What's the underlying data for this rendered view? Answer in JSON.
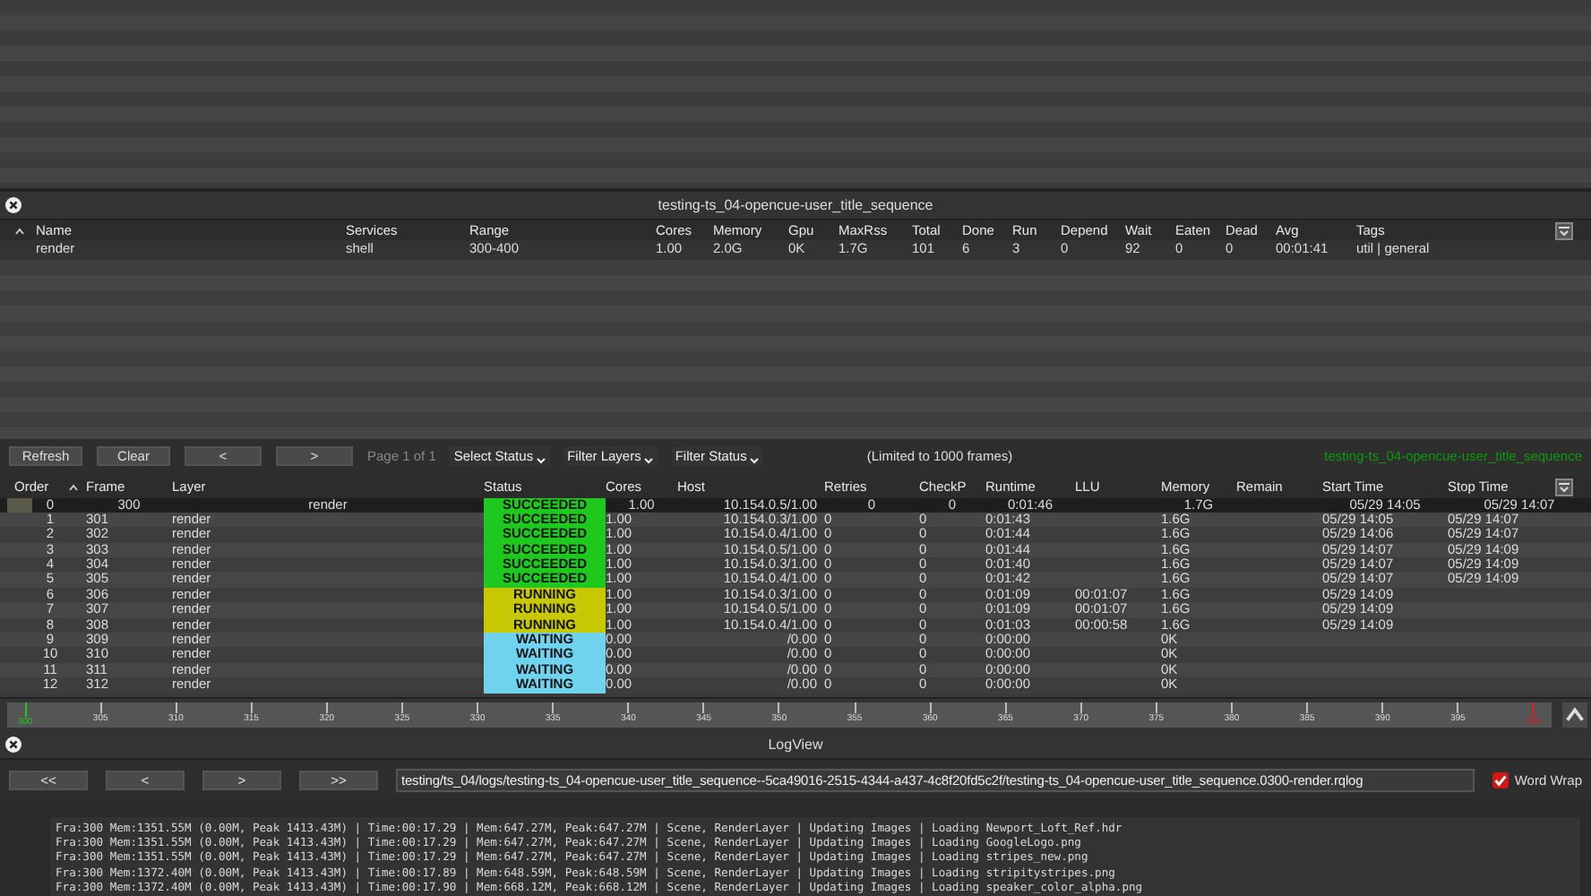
{
  "job_panel": {
    "title": "testing-ts_04-opencue-user_title_sequence",
    "columns": [
      "Name",
      "Services",
      "Range",
      "Cores",
      "Memory",
      "Gpu",
      "MaxRss",
      "Total",
      "Done",
      "Run",
      "Depend",
      "Wait",
      "Eaten",
      "Dead",
      "Avg",
      "Tags"
    ],
    "rows": [
      {
        "cells": [
          "render",
          "shell",
          "300-400",
          "1.00",
          "2.0G",
          "0K",
          "1.7G",
          "101",
          "6",
          "3",
          "0",
          "92",
          "0",
          "0",
          "00:01:41",
          "util | general"
        ]
      }
    ]
  },
  "frames_toolbar": {
    "buttons": [
      "Refresh",
      "Clear",
      "<",
      ">"
    ],
    "page_label": "Page 1 of 1",
    "menus": [
      "Select Status",
      "Filter Layers",
      "Filter Status"
    ],
    "limit_note": "(Limited to 1000 frames)",
    "job_name": "testing-ts_04-opencue-user_title_sequence"
  },
  "frames_table": {
    "columns": [
      "Order",
      "Frame",
      "Layer",
      "Status",
      "Cores",
      "Host",
      "Retries",
      "CheckP",
      "Runtime",
      "LLU",
      "Memory",
      "Remain",
      "Start Time",
      "Stop Time"
    ],
    "rows": [
      {
        "selected": true,
        "kind": "succeeded",
        "cells": [
          "0",
          "300",
          "render",
          "SUCCEEDED",
          "1.00",
          "10.154.0.5/1.00",
          "0",
          "0",
          "0:01:46",
          "",
          "1.7G",
          "",
          "05/29 14:05",
          "05/29 14:07"
        ]
      },
      {
        "selected": false,
        "kind": "succeeded",
        "cells": [
          "1",
          "301",
          "render",
          "SUCCEEDED",
          "1.00",
          "10.154.0.3/1.00",
          "0",
          "0",
          "0:01:43",
          "",
          "1.6G",
          "",
          "05/29 14:05",
          "05/29 14:07"
        ]
      },
      {
        "selected": false,
        "kind": "succeeded",
        "cells": [
          "2",
          "302",
          "render",
          "SUCCEEDED",
          "1.00",
          "10.154.0.4/1.00",
          "0",
          "0",
          "0:01:44",
          "",
          "1.6G",
          "",
          "05/29 14:06",
          "05/29 14:07"
        ]
      },
      {
        "selected": false,
        "kind": "succeeded",
        "cells": [
          "3",
          "303",
          "render",
          "SUCCEEDED",
          "1.00",
          "10.154.0.5/1.00",
          "0",
          "0",
          "0:01:44",
          "",
          "1.6G",
          "",
          "05/29 14:07",
          "05/29 14:09"
        ]
      },
      {
        "selected": false,
        "kind": "succeeded",
        "cells": [
          "4",
          "304",
          "render",
          "SUCCEEDED",
          "1.00",
          "10.154.0.3/1.00",
          "0",
          "0",
          "0:01:40",
          "",
          "1.6G",
          "",
          "05/29 14:07",
          "05/29 14:09"
        ]
      },
      {
        "selected": false,
        "kind": "succeeded",
        "cells": [
          "5",
          "305",
          "render",
          "SUCCEEDED",
          "1.00",
          "10.154.0.4/1.00",
          "0",
          "0",
          "0:01:42",
          "",
          "1.6G",
          "",
          "05/29 14:07",
          "05/29 14:09"
        ]
      },
      {
        "selected": false,
        "kind": "running",
        "cells": [
          "6",
          "306",
          "render",
          "RUNNING",
          "1.00",
          "10.154.0.3/1.00",
          "0",
          "0",
          "0:01:09",
          "00:01:07",
          "1.6G",
          "",
          "05/29 14:09",
          ""
        ]
      },
      {
        "selected": false,
        "kind": "running",
        "cells": [
          "7",
          "307",
          "render",
          "RUNNING",
          "1.00",
          "10.154.0.5/1.00",
          "0",
          "0",
          "0:01:09",
          "00:01:07",
          "1.6G",
          "",
          "05/29 14:09",
          ""
        ]
      },
      {
        "selected": false,
        "kind": "running",
        "cells": [
          "8",
          "308",
          "render",
          "RUNNING",
          "1.00",
          "10.154.0.4/1.00",
          "0",
          "0",
          "0:01:03",
          "00:00:58",
          "1.6G",
          "",
          "05/29 14:09",
          ""
        ]
      },
      {
        "selected": false,
        "kind": "waiting",
        "cells": [
          "9",
          "309",
          "render",
          "WAITING",
          "0.00",
          "/0.00",
          "0",
          "0",
          "0:00:00",
          "",
          "0K",
          "",
          "",
          ""
        ]
      },
      {
        "selected": false,
        "kind": "waiting",
        "cells": [
          "10",
          "310",
          "render",
          "WAITING",
          "0.00",
          "/0.00",
          "0",
          "0",
          "0:00:00",
          "",
          "0K",
          "",
          "",
          ""
        ]
      },
      {
        "selected": false,
        "kind": "waiting",
        "cells": [
          "11",
          "311",
          "render",
          "WAITING",
          "0.00",
          "/0.00",
          "0",
          "0",
          "0:00:00",
          "",
          "0K",
          "",
          "",
          ""
        ]
      },
      {
        "selected": false,
        "kind": "waiting",
        "cells": [
          "12",
          "312",
          "render",
          "WAITING",
          "0.00",
          "/0.00",
          "0",
          "0",
          "0:00:00",
          "",
          "0K",
          "",
          "",
          ""
        ]
      }
    ]
  },
  "timeline": {
    "ticks": [
      "300",
      "305",
      "310",
      "315",
      "320",
      "325",
      "330",
      "335",
      "340",
      "345",
      "350",
      "355",
      "360",
      "365",
      "370",
      "375",
      "380",
      "385",
      "390",
      "395",
      "400"
    ]
  },
  "log_view": {
    "title": "LogView",
    "nav_buttons": [
      "<<",
      "<",
      ">",
      ">>"
    ],
    "path": "testing/ts_04/logs/testing-ts_04-opencue-user_title_sequence--5ca49016-2515-4344-a437-4c8f20fd5c2f/testing-ts_04-opencue-user_title_sequence.0300-render.rqlog",
    "word_wrap": {
      "label": "Word Wrap",
      "checked": true
    },
    "lines": [
      "Fra:300 Mem:1351.55M (0.00M, Peak 1413.43M) | Time:00:17.29 | Mem:647.27M, Peak:647.27M | Scene, RenderLayer | Updating Images | Loading Newport_Loft_Ref.hdr",
      "Fra:300 Mem:1351.55M (0.00M, Peak 1413.43M) | Time:00:17.29 | Mem:647.27M, Peak:647.27M | Scene, RenderLayer | Updating Images | Loading GoogleLogo.png",
      "Fra:300 Mem:1351.55M (0.00M, Peak 1413.43M) | Time:00:17.29 | Mem:647.27M, Peak:647.27M | Scene, RenderLayer | Updating Images | Loading stripes_new.png",
      "Fra:300 Mem:1372.40M (0.00M, Peak 1413.43M) | Time:00:17.89 | Mem:648.59M, Peak:648.59M | Scene, RenderLayer | Updating Images | Loading stripitystripes.png",
      "Fra:300 Mem:1372.40M (0.00M, Peak 1413.43M) | Time:00:17.90 | Mem:668.12M, Peak:668.12M | Scene, RenderLayer | Updating Images | Loading speaker_color_alpha.png"
    ]
  }
}
